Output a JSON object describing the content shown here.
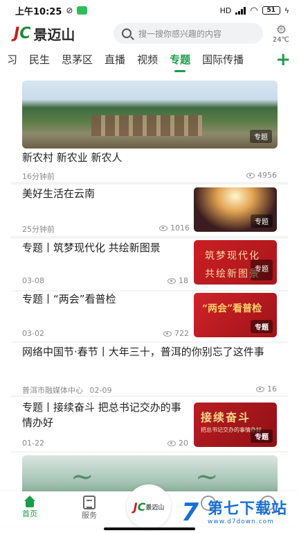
{
  "status_bar": {
    "time": "上午10:25",
    "network": "HD",
    "battery": "51"
  },
  "header": {
    "logo_text": "景迈山",
    "search_placeholder": "搜一搜你感兴趣的内容",
    "temperature": "24℃"
  },
  "tabs": [
    {
      "label": "习",
      "active": false
    },
    {
      "label": "民生",
      "active": false
    },
    {
      "label": "思茅区",
      "active": false
    },
    {
      "label": "直播",
      "active": false
    },
    {
      "label": "视频",
      "active": false
    },
    {
      "label": "专题",
      "active": true
    },
    {
      "label": "国际传播",
      "active": false
    }
  ],
  "feed": {
    "hero": {
      "tag": "专题",
      "title": "新农村 新农业 新农人",
      "time": "16分钟前",
      "views": "4956"
    },
    "items": [
      {
        "title": "美好生活在云南",
        "time": "25分钟前",
        "views": "1016",
        "tag": "专题"
      },
      {
        "title": "专题丨筑梦现代化 共绘新图景",
        "time": "03-08",
        "views": "18",
        "tag": "专题",
        "thumb_line1": "筑梦现代化",
        "thumb_line2": "共绘新图景"
      },
      {
        "title": "专题丨“两会”看普检",
        "time": "03-02",
        "views": "722",
        "tag": "专题",
        "thumb_text": "“两会”看普检"
      },
      {
        "title": "网络中国节·春节丨大年三十，普洱的你别忘了这件事",
        "source": "普洱市融媒体中心",
        "time": "02-09",
        "views": "16"
      },
      {
        "title": "专题丨接续奋斗 把总书记交办的事情办好",
        "time": "01-22",
        "views": "20",
        "tag": "专题",
        "thumb_text": "接续奋斗",
        "thumb_sub": "把总书记交办的事情办好"
      }
    ]
  },
  "bottom_nav": {
    "home": "首页",
    "service": "服务",
    "center_logo": "景迈山"
  },
  "watermark": {
    "title": "第七下载站",
    "url": "www.d7down.com"
  },
  "colors": {
    "accent": "#1c9b4a",
    "brand_red": "#c0211f"
  }
}
